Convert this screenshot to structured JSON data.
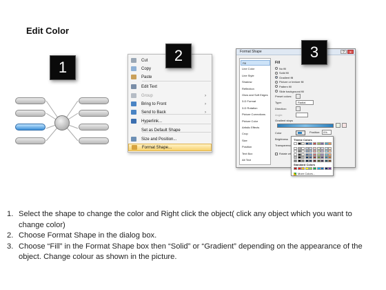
{
  "title": "Edit Color",
  "steps": [
    "1",
    "2",
    "3"
  ],
  "context_menu": {
    "items": [
      {
        "label": "Cut",
        "icon": "scissors-icon",
        "color": "#9aa7b5",
        "disabled": false,
        "arrow": ""
      },
      {
        "label": "Copy",
        "icon": "copy-icon",
        "color": "#8fb1d6",
        "disabled": false,
        "arrow": ""
      },
      {
        "label": "Paste",
        "icon": "paste-icon",
        "color": "#c9a05a",
        "disabled": false,
        "arrow": ""
      },
      {
        "label": "Edit Text",
        "icon": "edit-text-icon",
        "color": "#7a8ea8",
        "disabled": false,
        "arrow": ""
      },
      {
        "label": "Group",
        "icon": "group-icon",
        "color": "#b5bcc5",
        "disabled": true,
        "arrow": "›"
      },
      {
        "label": "Bring to Front",
        "icon": "bring-to-front-icon",
        "color": "#4a84c4",
        "disabled": false,
        "arrow": "›"
      },
      {
        "label": "Send to Back",
        "icon": "send-to-back-icon",
        "color": "#4a84c4",
        "disabled": false,
        "arrow": "›"
      },
      {
        "label": "Hyperlink...",
        "icon": "hyperlink-icon",
        "color": "#3b6fb0",
        "disabled": false,
        "arrow": ""
      },
      {
        "label": "Set as Default Shape",
        "icon": "",
        "color": "",
        "disabled": false,
        "arrow": ""
      },
      {
        "label": "Size and Position...",
        "icon": "size-position-icon",
        "color": "#6d8fb5",
        "disabled": false,
        "arrow": ""
      },
      {
        "label": "Format Shape...",
        "icon": "format-shape-icon",
        "color": "#d7a33e",
        "disabled": false,
        "arrow": "",
        "highlight": true
      }
    ]
  },
  "dialog": {
    "title": "Format Shape",
    "controls": {
      "help": "?",
      "close": "x"
    },
    "categories": [
      "Fill",
      "Line Color",
      "Line Style",
      "Shadow",
      "Reflection",
      "Glow and Soft Edges",
      "3-D Format",
      "3-D Rotation",
      "Picture Corrections",
      "Picture Color",
      "Artistic Effects",
      "Crop",
      "Size",
      "Position",
      "Text Box",
      "Alt Text"
    ],
    "fill_heading": "Fill",
    "fill_options": [
      {
        "label": "No fill",
        "selected": false
      },
      {
        "label": "Solid fill",
        "selected": false
      },
      {
        "label": "Gradient fill",
        "selected": true
      },
      {
        "label": "Picture or texture fill",
        "selected": false
      },
      {
        "label": "Pattern fill",
        "selected": false
      },
      {
        "label": "Slide background fill",
        "selected": false
      }
    ],
    "fields": {
      "preset_colors": "Preset colors:",
      "type_label": "Type:",
      "type_value": "Radial",
      "direction": "Direction:",
      "angle": "Angle:",
      "gradient_stops": "Gradient stops",
      "color": "Color",
      "position_label": "Position:",
      "position_value": "0%",
      "brightness": "Brightness",
      "transparency": "Transparency",
      "rotate": "Rotate with shape"
    }
  },
  "palette": {
    "theme_heading": "Theme Colors",
    "standard_heading": "Standard Colors",
    "more_colors": "More Colors...",
    "theme_top": [
      "#ffffff",
      "#000000",
      "#eeece1",
      "#1f497d",
      "#4f81bd",
      "#c0504d",
      "#9bbb59",
      "#8064a2",
      "#4bacc6",
      "#f79646"
    ],
    "standard": [
      "#c00000",
      "#ff0000",
      "#ffc000",
      "#ffff00",
      "#92d050",
      "#00b050",
      "#00b0f0",
      "#0070c0",
      "#002060",
      "#7030a0"
    ]
  },
  "instructions": [
    {
      "num": "1.",
      "text": "Select the shape to change the color and Right click the object( click any object which you want to change color)"
    },
    {
      "num": "2.",
      "text": "Choose Format Shape in the dialog box."
    },
    {
      "num": "3.",
      "text": "Choose “Fill” in the Format Shape box then “Solid” or “Gradient” depending on the appearance of the object. Change colour as shown in the picture."
    }
  ]
}
